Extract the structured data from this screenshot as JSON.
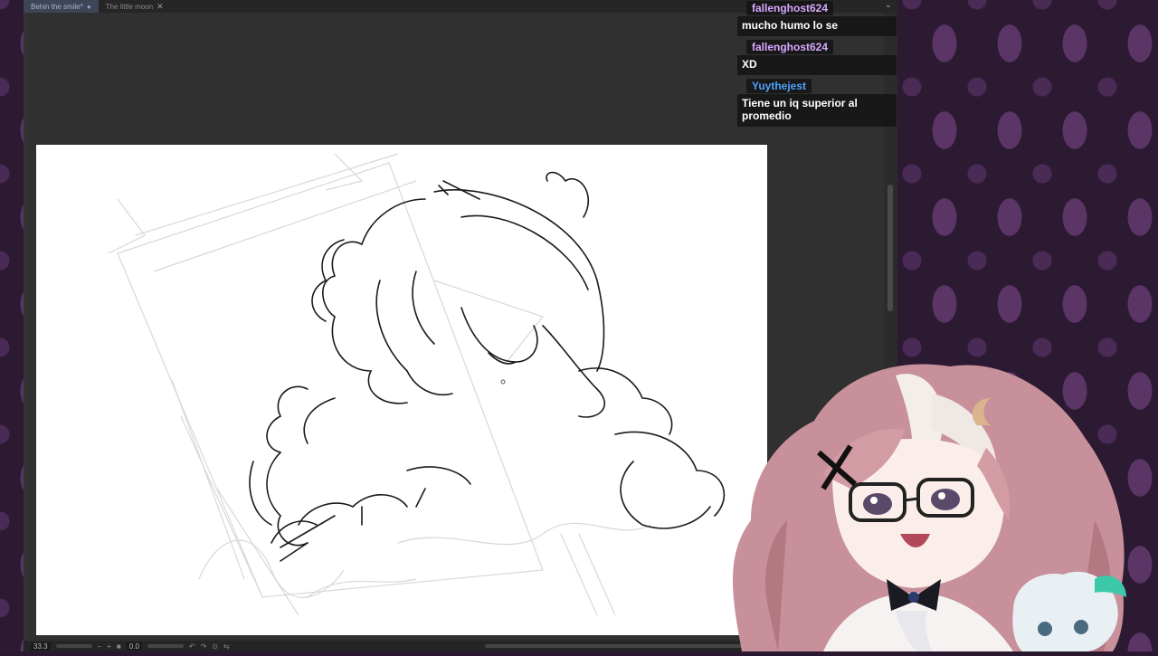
{
  "tabs": [
    {
      "label": "Behin the smile*",
      "active": true,
      "modified_indicator": "●"
    },
    {
      "label": "The little moon",
      "active": false,
      "close_glyph": "✕"
    }
  ],
  "tab_menu_glyph": "⌄",
  "statusbar": {
    "zoom": "33.3",
    "rotation": "0.0"
  },
  "chat": {
    "messages": [
      {
        "user": "fallenghost624",
        "user_color": "#d7a8ff",
        "text": "mucho humo lo se"
      },
      {
        "user": "fallenghost624",
        "user_color": "#d7a8ff",
        "text": "XD"
      },
      {
        "user": "Yuythejest",
        "user_color": "#4da3ff",
        "text": "Tiene un iq superior al promedio"
      }
    ]
  },
  "colors": {
    "background": "#2c1a33",
    "app_panel": "#333333",
    "canvas": "#ffffff",
    "tab_active": "#3d4557"
  },
  "icons": [
    "close-icon",
    "chevron-down-icon",
    "zoom-minus-icon",
    "zoom-plus-icon",
    "rotate-icon",
    "flip-icon"
  ]
}
